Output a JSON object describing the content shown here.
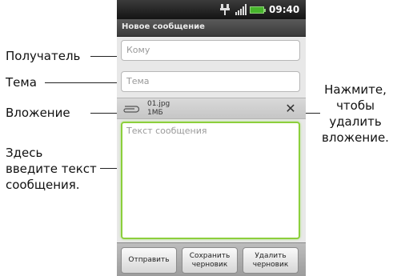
{
  "callouts": {
    "recipient": "Получатель",
    "subject": "Тема",
    "attachment": "Вложение",
    "message": "Здесь\nвведите текст\nсообщения.",
    "remove_hint": "Нажмите,\nчтобы\nудалить\nвложение."
  },
  "status_bar": {
    "time": "09:40",
    "icons": [
      "usb-icon",
      "signal-icon",
      "battery-icon"
    ]
  },
  "window": {
    "title": "Новое сообщение"
  },
  "compose": {
    "to_placeholder": "Кому",
    "subject_placeholder": "Тема",
    "message_placeholder": "Текст сообщения",
    "attachment": {
      "file_name": "01.jpg",
      "file_size": "1МБ",
      "remove_icon": "close-icon"
    }
  },
  "buttons": {
    "send": "Отправить",
    "save_draft": "Сохранить\nчерновик",
    "delete_draft": "Удалить\nчерновик"
  },
  "colors": {
    "focus_border": "#8ccf3c",
    "callout_marker": "#1f55a8",
    "battery": "#47b52c"
  }
}
